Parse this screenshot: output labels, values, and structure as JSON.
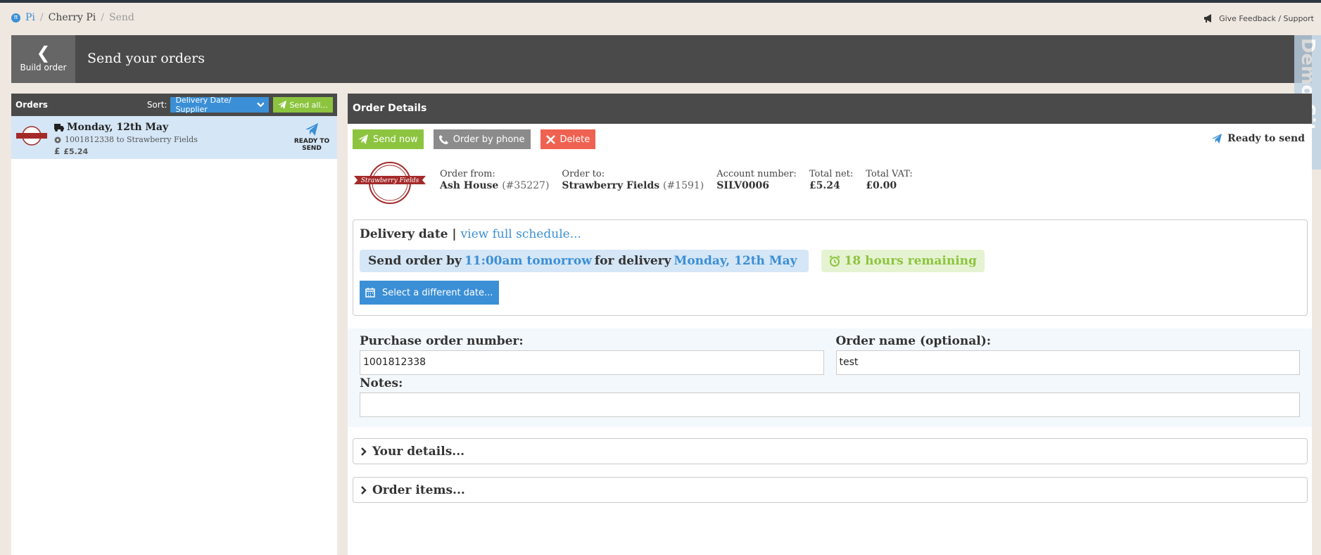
{
  "breadcrumb": {
    "home": "Pi",
    "site": "Cherry Pi",
    "current": "Send"
  },
  "feedback_label": "Give Feedback / Support",
  "header": {
    "back_label": "Build order",
    "title": "Send your orders"
  },
  "demo_label": "Demo Site",
  "orders": {
    "title": "Orders",
    "sort_label": "Sort:",
    "sort_value": "Delivery Date/ Supplier",
    "send_all": "Send all...",
    "items": [
      {
        "date": "Monday, 12th May",
        "desc": "1001812338 to Strawberry Fields",
        "price": "£5.24",
        "status": "READY TO SEND"
      }
    ]
  },
  "details": {
    "title": "Order Details",
    "send_now": "Send now",
    "order_by_phone": "Order by phone",
    "delete": "Delete",
    "status": "Ready to send",
    "logo_text": "Strawberry Fields",
    "order_from_label": "Order from:",
    "order_from": "Ash House",
    "order_from_id": "(#35227)",
    "order_to_label": "Order to:",
    "order_to": "Strawberry Fields",
    "order_to_id": "(#1591)",
    "account_label": "Account number:",
    "account": "SILV0006",
    "total_net_label": "Total net:",
    "total_net": "£5.24",
    "total_vat_label": "Total VAT:",
    "total_vat": "£0.00"
  },
  "delivery": {
    "title": "Delivery date",
    "schedule_link": "view full schedule...",
    "send_by": "Send order by",
    "time": "11:00am tomorrow",
    "for_delivery": "for delivery",
    "date": "Monday, 12th May",
    "remaining": "18 hours remaining",
    "select_date": "Select a different date..."
  },
  "form": {
    "po_label": "Purchase order number:",
    "po_value": "1001812338",
    "name_label": "Order name (optional):",
    "name_value": "test",
    "notes_label": "Notes:",
    "notes_value": ""
  },
  "sections": {
    "your_details": "Your details...",
    "order_items": "Order items..."
  },
  "colors": {
    "accent": "#3b8fd6",
    "green": "#8cc43f",
    "red": "#ef6251",
    "dark": "#4a4a4a"
  }
}
